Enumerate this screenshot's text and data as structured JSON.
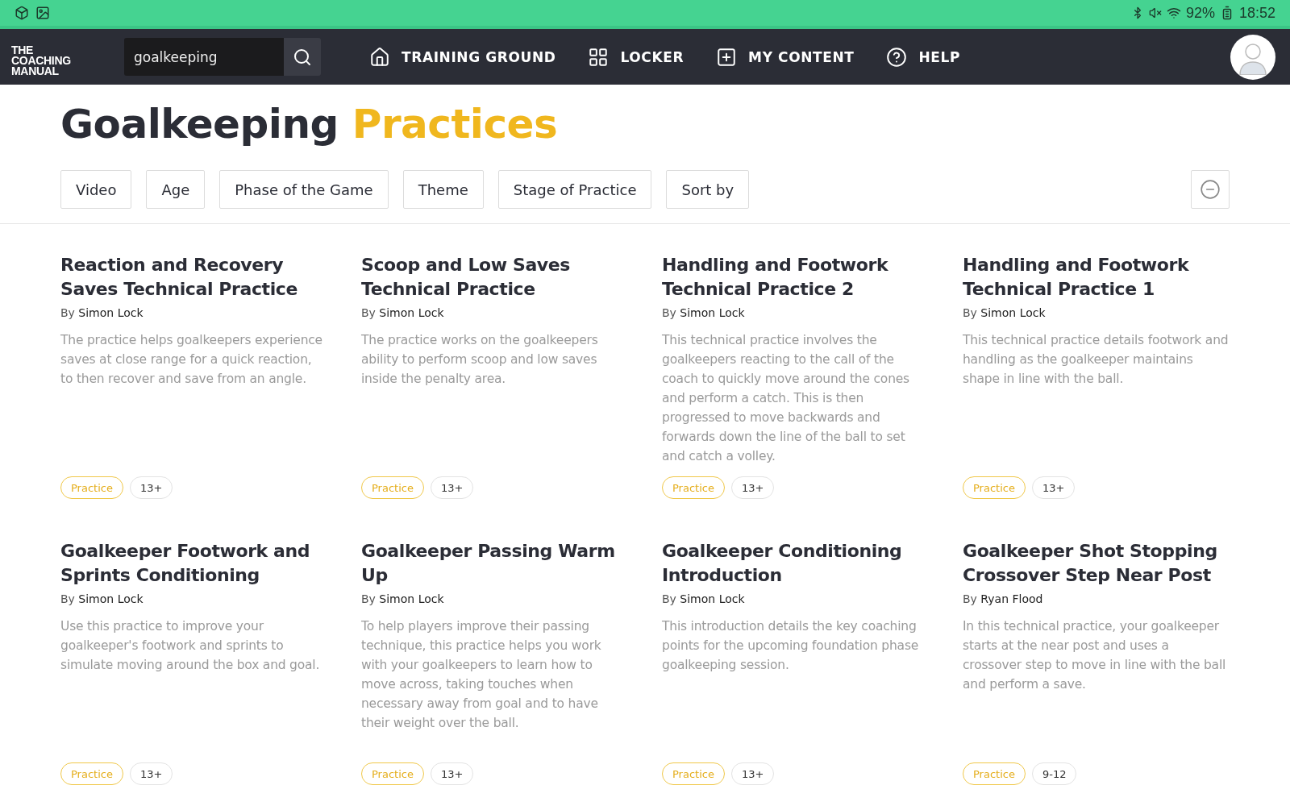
{
  "status_bar": {
    "battery": "92%",
    "time": "18:52"
  },
  "header": {
    "logo": [
      "THE",
      "COACHING",
      "MANUAL"
    ],
    "search": {
      "value": "goalkeeping"
    },
    "nav": [
      {
        "label": "TRAINING GROUND"
      },
      {
        "label": "LOCKER"
      },
      {
        "label": "MY CONTENT"
      },
      {
        "label": "HELP"
      }
    ]
  },
  "title": {
    "main": "Goalkeeping",
    "highlight": "Practices"
  },
  "filters": [
    "Video",
    "Age",
    "Phase of the Game",
    "Theme",
    "Stage of Practice",
    "Sort by"
  ],
  "cards": [
    {
      "title": "Reaction and Recovery Saves Technical Practice",
      "by": "By",
      "author": "Simon Lock",
      "description": "The practice helps goalkeepers experience saves at close range for a quick reaction, to then recover and save from an angle.",
      "tags": [
        {
          "kind": "type",
          "label": "Practice"
        },
        {
          "kind": "age",
          "label": "13+"
        }
      ]
    },
    {
      "title": "Scoop and Low Saves Technical Practice",
      "by": "By",
      "author": "Simon Lock",
      "description": "The practice works on the goalkeepers ability to perform scoop and low saves inside the penalty area.",
      "tags": [
        {
          "kind": "type",
          "label": "Practice"
        },
        {
          "kind": "age",
          "label": "13+"
        }
      ]
    },
    {
      "title": "Handling and Footwork Technical Practice 2",
      "by": "By",
      "author": "Simon Lock",
      "description": "This technical practice involves the goalkeepers reacting to the call of the coach to quickly move around the cones and perform a catch. This is then progressed to move backwards and forwards down the line of the ball to set and catch a volley.",
      "tags": [
        {
          "kind": "type",
          "label": "Practice"
        },
        {
          "kind": "age",
          "label": "13+"
        }
      ]
    },
    {
      "title": "Handling and Footwork Technical Practice 1",
      "by": "By",
      "author": "Simon Lock",
      "description": "This technical practice details footwork and handling as the goalkeeper maintains shape in line with the ball.",
      "tags": [
        {
          "kind": "type",
          "label": "Practice"
        },
        {
          "kind": "age",
          "label": "13+"
        }
      ]
    },
    {
      "title": "Goalkeeper Footwork and Sprints Conditioning",
      "by": "By",
      "author": "Simon Lock",
      "description": "Use this practice to improve your goalkeeper's footwork and sprints to simulate moving around the box and goal.",
      "tags": [
        {
          "kind": "type",
          "label": "Practice"
        },
        {
          "kind": "age",
          "label": "13+"
        }
      ]
    },
    {
      "title": "Goalkeeper Passing Warm Up",
      "by": "By",
      "author": "Simon Lock",
      "description": "To help players improve their passing technique, this practice helps you work with your goalkeepers to learn how to move across, taking touches when necessary away from goal and to have their weight over the ball.",
      "tags": [
        {
          "kind": "type",
          "label": "Practice"
        },
        {
          "kind": "age",
          "label": "13+"
        }
      ]
    },
    {
      "title": "Goalkeeper Conditioning Introduction",
      "by": "By",
      "author": "Simon Lock",
      "description": "This introduction details the key coaching points for the upcoming foundation phase goalkeeping session.",
      "tags": [
        {
          "kind": "type",
          "label": "Practice"
        },
        {
          "kind": "age",
          "label": "13+"
        }
      ]
    },
    {
      "title": "Goalkeeper Shot Stopping Crossover Step Near Post",
      "by": "By",
      "author": "Ryan Flood",
      "description": "In this technical practice, your goalkeeper starts at the near post and uses a crossover step to move in line with the ball and perform a save.",
      "tags": [
        {
          "kind": "type",
          "label": "Practice"
        },
        {
          "kind": "age",
          "label": "9-12"
        }
      ]
    }
  ]
}
